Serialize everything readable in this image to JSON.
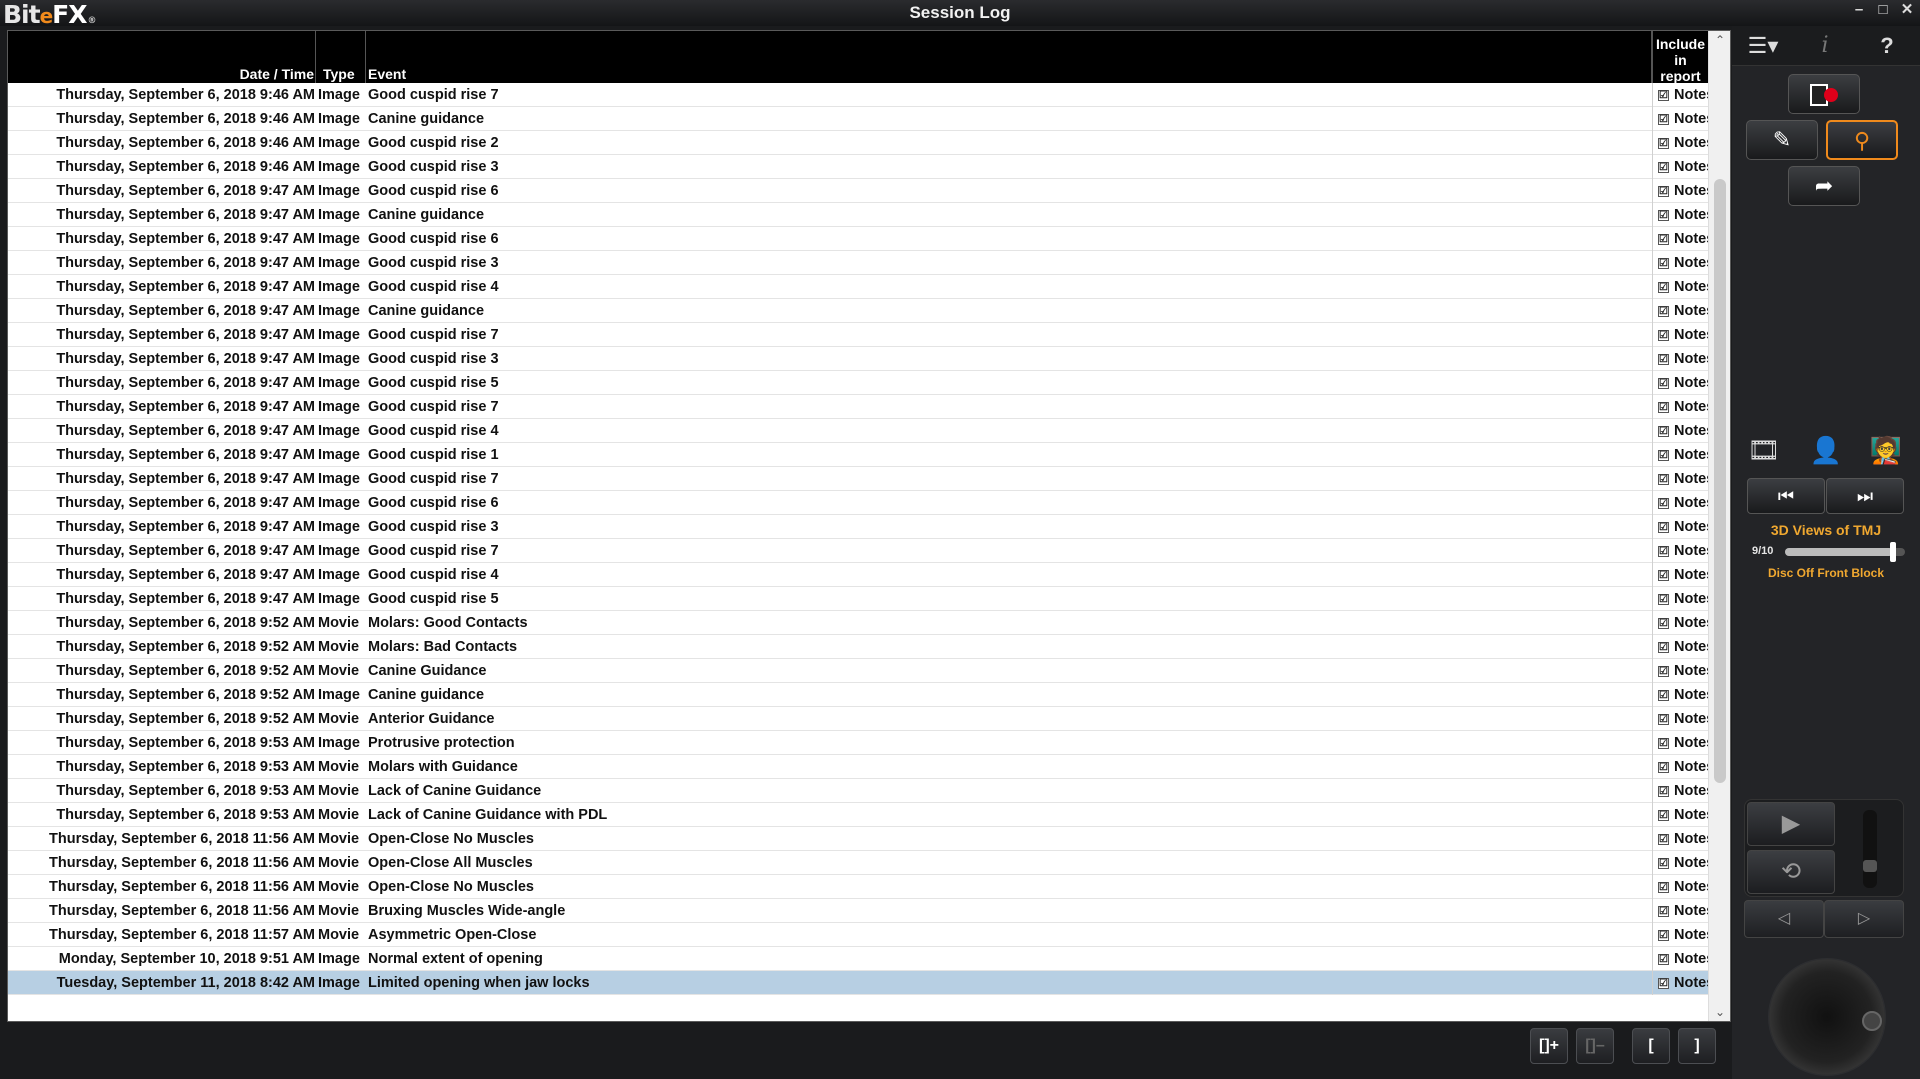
{
  "app": {
    "logo_text_bite": "Bit",
    "logo_text_e": "e",
    "logo_text_fx": "FX",
    "logo_reg": "®",
    "title": "Session Log",
    "win_minimize": "–",
    "win_maximize": "□",
    "win_close": "✕"
  },
  "table": {
    "columns": {
      "date": "Date / Time",
      "type": "Type",
      "event": "Event",
      "include": "Include in report"
    },
    "checkbox_glyph": "☑",
    "notes_label": "Notes",
    "selected_row_index": 37,
    "rows": [
      {
        "date": "Thursday, September 6, 2018 9:46 AM",
        "type": "Image",
        "event": "Good cuspid rise 7"
      },
      {
        "date": "Thursday, September 6, 2018 9:46 AM",
        "type": "Image",
        "event": "Canine guidance"
      },
      {
        "date": "Thursday, September 6, 2018 9:46 AM",
        "type": "Image",
        "event": "Good cuspid rise 2"
      },
      {
        "date": "Thursday, September 6, 2018 9:46 AM",
        "type": "Image",
        "event": "Good cuspid rise 3"
      },
      {
        "date": "Thursday, September 6, 2018 9:47 AM",
        "type": "Image",
        "event": "Good cuspid rise 6"
      },
      {
        "date": "Thursday, September 6, 2018 9:47 AM",
        "type": "Image",
        "event": "Canine guidance"
      },
      {
        "date": "Thursday, September 6, 2018 9:47 AM",
        "type": "Image",
        "event": "Good cuspid rise 6"
      },
      {
        "date": "Thursday, September 6, 2018 9:47 AM",
        "type": "Image",
        "event": "Good cuspid rise 3"
      },
      {
        "date": "Thursday, September 6, 2018 9:47 AM",
        "type": "Image",
        "event": "Good cuspid rise 4"
      },
      {
        "date": "Thursday, September 6, 2018 9:47 AM",
        "type": "Image",
        "event": "Canine guidance"
      },
      {
        "date": "Thursday, September 6, 2018 9:47 AM",
        "type": "Image",
        "event": "Good cuspid rise 7"
      },
      {
        "date": "Thursday, September 6, 2018 9:47 AM",
        "type": "Image",
        "event": "Good cuspid rise 3"
      },
      {
        "date": "Thursday, September 6, 2018 9:47 AM",
        "type": "Image",
        "event": "Good cuspid rise 5"
      },
      {
        "date": "Thursday, September 6, 2018 9:47 AM",
        "type": "Image",
        "event": "Good cuspid rise 7"
      },
      {
        "date": "Thursday, September 6, 2018 9:47 AM",
        "type": "Image",
        "event": "Good cuspid rise 4"
      },
      {
        "date": "Thursday, September 6, 2018 9:47 AM",
        "type": "Image",
        "event": "Good cuspid rise 1"
      },
      {
        "date": "Thursday, September 6, 2018 9:47 AM",
        "type": "Image",
        "event": "Good cuspid rise 7"
      },
      {
        "date": "Thursday, September 6, 2018 9:47 AM",
        "type": "Image",
        "event": "Good cuspid rise 6"
      },
      {
        "date": "Thursday, September 6, 2018 9:47 AM",
        "type": "Image",
        "event": "Good cuspid rise 3"
      },
      {
        "date": "Thursday, September 6, 2018 9:47 AM",
        "type": "Image",
        "event": "Good cuspid rise 7"
      },
      {
        "date": "Thursday, September 6, 2018 9:47 AM",
        "type": "Image",
        "event": "Good cuspid rise 4"
      },
      {
        "date": "Thursday, September 6, 2018 9:47 AM",
        "type": "Image",
        "event": "Good cuspid rise 5"
      },
      {
        "date": "Thursday, September 6, 2018 9:52 AM",
        "type": "Movie",
        "event": "Molars: Good Contacts"
      },
      {
        "date": "Thursday, September 6, 2018 9:52 AM",
        "type": "Movie",
        "event": "Molars: Bad Contacts"
      },
      {
        "date": "Thursday, September 6, 2018 9:52 AM",
        "type": "Movie",
        "event": "Canine Guidance"
      },
      {
        "date": "Thursday, September 6, 2018 9:52 AM",
        "type": "Image",
        "event": "Canine guidance"
      },
      {
        "date": "Thursday, September 6, 2018 9:52 AM",
        "type": "Movie",
        "event": "Anterior Guidance"
      },
      {
        "date": "Thursday, September 6, 2018 9:53 AM",
        "type": "Image",
        "event": "Protrusive protection"
      },
      {
        "date": "Thursday, September 6, 2018 9:53 AM",
        "type": "Movie",
        "event": "Molars with Guidance"
      },
      {
        "date": "Thursday, September 6, 2018 9:53 AM",
        "type": "Movie",
        "event": "Lack of Canine Guidance"
      },
      {
        "date": "Thursday, September 6, 2018 9:53 AM",
        "type": "Movie",
        "event": "Lack of Canine Guidance with PDL"
      },
      {
        "date": "Thursday, September 6, 2018 11:56 AM",
        "type": "Movie",
        "event": "Open-Close No Muscles"
      },
      {
        "date": "Thursday, September 6, 2018 11:56 AM",
        "type": "Movie",
        "event": "Open-Close All Muscles"
      },
      {
        "date": "Thursday, September 6, 2018 11:56 AM",
        "type": "Movie",
        "event": "Open-Close No Muscles"
      },
      {
        "date": "Thursday, September 6, 2018 11:56 AM",
        "type": "Movie",
        "event": "Bruxing Muscles Wide-angle"
      },
      {
        "date": "Thursday, September 6, 2018 11:57 AM",
        "type": "Movie",
        "event": "Asymmetric Open-Close"
      },
      {
        "date": "Monday, September 10, 2018 9:51 AM",
        "type": "Image",
        "event": "Normal extent of opening"
      },
      {
        "date": "Tuesday, September 11, 2018 8:42 AM",
        "type": "Image",
        "event": "Limited opening when jaw locks"
      }
    ]
  },
  "scrollbar": {
    "up_arrow": "⌃",
    "down_arrow": "⌄",
    "position_fraction": 0.37
  },
  "bottom_buttons": {
    "add_bracket": "[]+",
    "remove_bracket": "[]–",
    "open_bracket": "[",
    "close_bracket": "]"
  },
  "right_panel": {
    "menu_icon": "☰▾",
    "info_icon": "i",
    "help_icon": "?",
    "edit_icon": "✎",
    "search_icon": "⚲",
    "export_icon": "➦",
    "film_icon": "🎞",
    "portrait_icon": "👤",
    "presenter_icon": "🧑‍🏫",
    "prev_icon": "⏮",
    "next_icon": "⏭",
    "sequence_title": "3D Views of TMJ",
    "sequence_count": "9/10",
    "sequence_position": 0.9,
    "sequence_subtitle": "Disc Off Front Block",
    "play_icon": "▶",
    "loop_icon": "⟲",
    "step_back_icon": "◁",
    "step_forward_icon": "▷",
    "speed_level": 0.25
  },
  "colors": {
    "accent_orange": "#f08a1c",
    "sequence_text": "#f0a830",
    "selected_row": "#b7cfe3",
    "record_red": "#e0001a"
  }
}
